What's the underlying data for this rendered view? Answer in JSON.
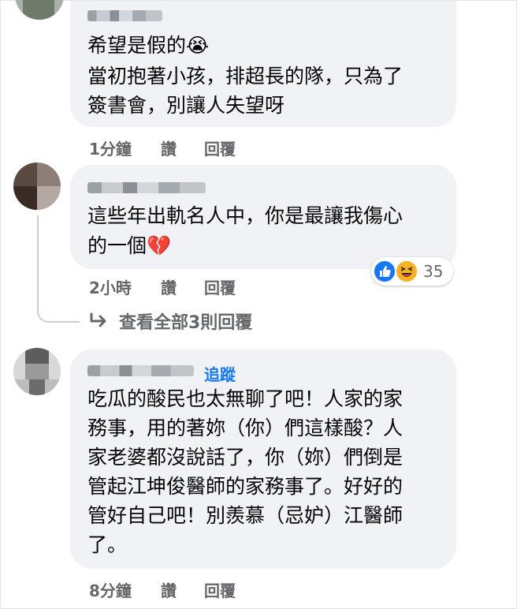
{
  "comments": [
    {
      "text_lines": [
        "希望是假的",
        "當初抱著小孩，排超長的隊，只為了",
        "簽書會，別讓人失望呀"
      ],
      "emoji": "😭",
      "time": "1分鐘",
      "like_label": "讚",
      "reply_label": "回覆"
    },
    {
      "text_lines": [
        "這些年出軌名人中，你是最讓我傷心",
        "的一個"
      ],
      "emoji": "💔",
      "time": "2小時",
      "like_label": "讚",
      "reply_label": "回覆",
      "reaction_count": "35",
      "view_replies": "查看全部3則回覆"
    },
    {
      "follow_label": "追蹤",
      "text_lines": [
        "吃瓜的酸民也太無聊了吧！人家的家",
        "務事，用的著妳（你）們這樣酸？人",
        "家老婆都沒說話了，你（妳）們倒是",
        "管起江坤俊醫師的家務事了。好好的",
        "管好自己吧！別羨慕（忌妒）江醫師",
        "了。"
      ],
      "time": "8分鐘",
      "like_label": "讚",
      "reply_label": "回覆"
    }
  ],
  "colors": {
    "bubble": "#f0f2f5",
    "meta_text": "#65676b",
    "follow_blue": "#1877f2"
  }
}
